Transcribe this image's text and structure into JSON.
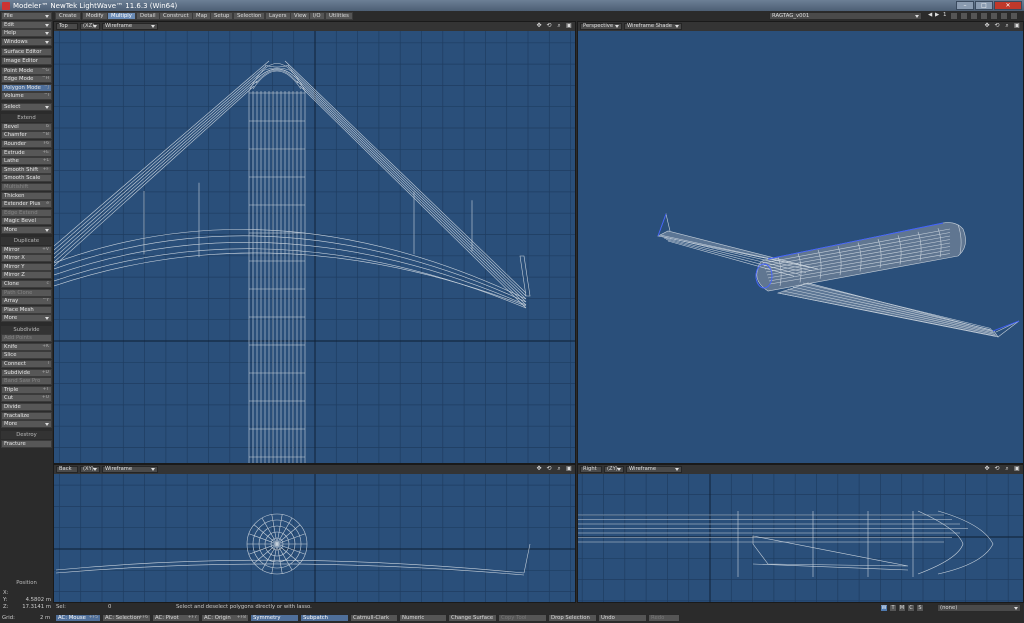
{
  "window": {
    "title": "Modeler™ NewTek LightWave™ 11.6.3 (Win64)"
  },
  "menu": [
    {
      "label": "File",
      "arrow": true
    },
    {
      "label": "Edit",
      "arrow": true
    },
    {
      "label": "Help",
      "arrow": true
    },
    {
      "label": "Windows",
      "arrow": true
    },
    {
      "label": "Surface Editor"
    },
    {
      "label": "Image Editor"
    },
    {
      "label": "Point Mode",
      "sc": "^G"
    },
    {
      "label": "Edge Mode",
      "sc": "^H"
    },
    {
      "label": "Polygon Mode",
      "sc": "^J"
    },
    {
      "label": "Volume",
      "sc": "^I"
    },
    {
      "label": "Select",
      "arrow": true
    }
  ],
  "extend": {
    "header": "Extend",
    "items": [
      {
        "label": "Bevel",
        "sc": "b"
      },
      {
        "label": "Chamfer",
        "sc": "^B"
      },
      {
        "label": "Rounder",
        "sc": "F6"
      },
      {
        "label": "Extrude",
        "sc": "+E"
      },
      {
        "label": "Lathe",
        "sc": "+L"
      },
      {
        "label": "Smooth Shift",
        "sc": "+F"
      },
      {
        "label": "Smooth Scale"
      },
      {
        "label": "Multishift"
      },
      {
        "label": "Thicken"
      },
      {
        "label": "Extender Plus",
        "sc": "e"
      },
      {
        "label": "Edge Extend"
      },
      {
        "label": "Magic Bevel"
      },
      {
        "label": "More",
        "arrow": true
      }
    ]
  },
  "duplicate": {
    "header": "Duplicate",
    "items": [
      {
        "label": "Mirror",
        "sc": "+V"
      },
      {
        "label": "Mirror X"
      },
      {
        "label": "Mirror Y"
      },
      {
        "label": "Mirror Z"
      },
      {
        "label": "Clone",
        "sc": "c"
      },
      {
        "label": "Path Clone"
      },
      {
        "label": "Array",
        "sc": "^Y"
      },
      {
        "label": "Place Mesh"
      },
      {
        "label": "More",
        "arrow": true
      }
    ]
  },
  "subdivide": {
    "header": "Subdivide",
    "items": [
      {
        "label": "Add Points"
      },
      {
        "label": "Knife",
        "sc": "+K"
      },
      {
        "label": "Slice"
      },
      {
        "label": "Connect",
        "sc": "l"
      },
      {
        "label": "Subdivide",
        "sc": "+D"
      },
      {
        "label": "Band Saw Pro"
      },
      {
        "label": "Triple",
        "sc": "+T"
      },
      {
        "label": "Cut",
        "sc": "+U"
      },
      {
        "label": "Divide"
      },
      {
        "label": "Fractalize"
      },
      {
        "label": "More",
        "arrow": true
      }
    ]
  },
  "destroy": {
    "header": "Destroy",
    "items": [
      {
        "label": "Fracture"
      }
    ]
  },
  "position": {
    "title": "Position",
    "x_label": "X:",
    "x": "",
    "y_label": "Y:",
    "y": "4.5802 m",
    "z_label": "Z:",
    "z": "17.3141 m"
  },
  "tabs": [
    "Create",
    "Modify",
    "Multiply",
    "Detail",
    "Construct",
    "Map",
    "Setup",
    "Selection",
    "Layers",
    "View",
    "I/O",
    "Utilities"
  ],
  "active_tab": "Multiply",
  "layer": {
    "object": "RAGTAG_v001",
    "layer_num": "1"
  },
  "viewports": {
    "top": {
      "view": "Top",
      "axes": "(XZ)",
      "mode": "Wireframe"
    },
    "perspective": {
      "view": "Perspective",
      "mode": "Wireframe Shade"
    },
    "back": {
      "view": "Back",
      "axes": "(XY)",
      "mode": "Wireframe"
    },
    "right": {
      "view": "Right",
      "axes": "(ZY)",
      "mode": "Wireframe"
    }
  },
  "status": {
    "sel_label": "Sel:",
    "sel_count": "0",
    "hint": "Select and deselect polygons directly or with lasso.",
    "wtmcs": [
      "W",
      "T",
      "M",
      "C",
      "S"
    ],
    "surface": "(none)"
  },
  "bottom": {
    "grid_label": "Grid:",
    "grid_value": "2 m",
    "buttons": [
      {
        "label": "AC: Mouse",
        "sc": "+F5",
        "on": true
      },
      {
        "label": "AC: Selection",
        "sc": "+F6"
      },
      {
        "label": "AC: Pivot",
        "sc": "+F7"
      },
      {
        "label": "AC: Origin",
        "sc": "+F8"
      },
      {
        "label": "Symmetry",
        "on": true
      },
      {
        "label": "Subpatch",
        "on": true
      },
      {
        "label": "Catmull-Clark"
      },
      {
        "label": "Numeric"
      },
      {
        "label": "Change Surface"
      },
      {
        "label": "Copy Tool",
        "dim": true
      },
      {
        "label": "Drop Selection"
      },
      {
        "label": "Undo"
      },
      {
        "label": "Redo",
        "dim": true
      }
    ]
  },
  "colors": {
    "viewport_bg": "#2a4f7a",
    "grid_major": "#1f3d61",
    "wire": "#c8d2dc",
    "selected_edge": "#4060ff",
    "accent": "#6a8bb5"
  }
}
